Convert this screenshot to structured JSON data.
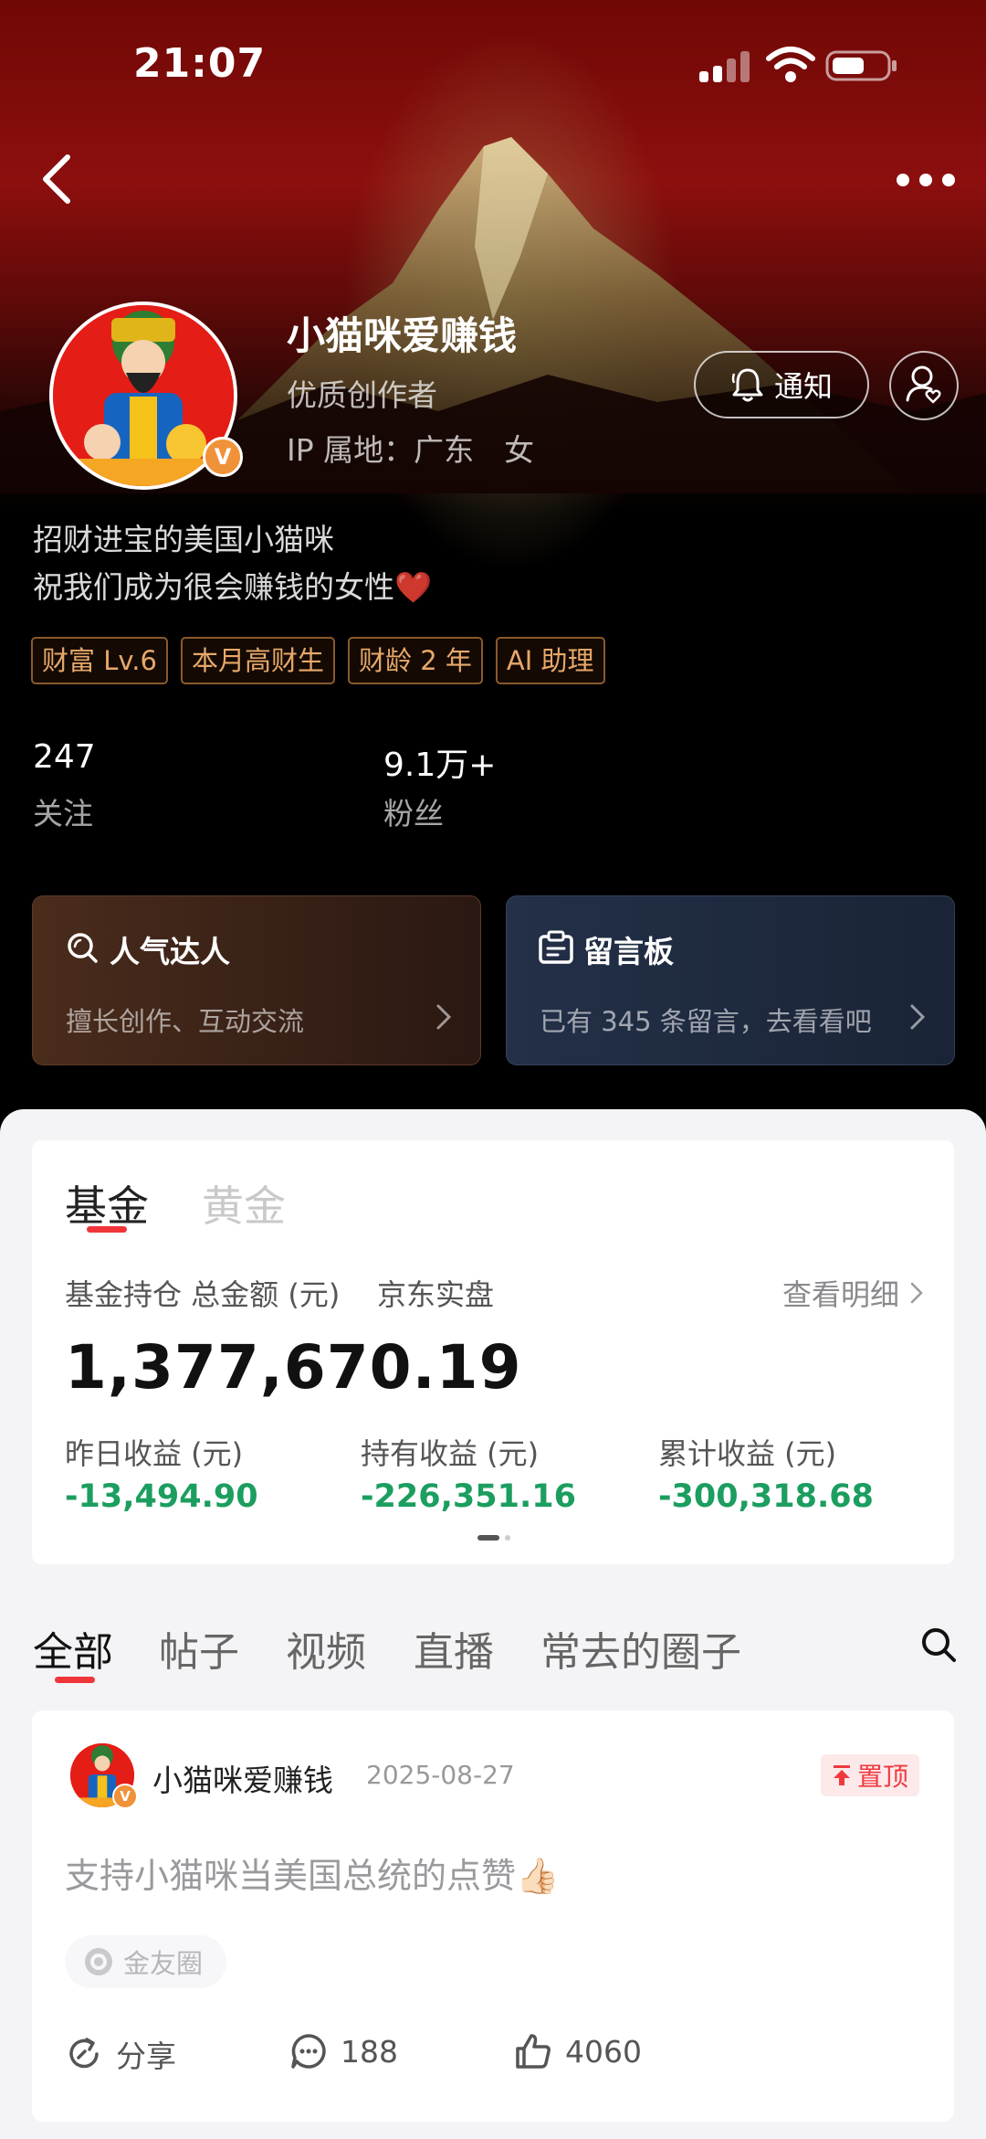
{
  "status_bar": {
    "time": "21:07"
  },
  "profile": {
    "nickname": "小猫咪爱赚钱",
    "verified_badge": "V",
    "role": "优质创作者",
    "ip_location": "IP 属地：广东　女",
    "notify_label": "通知",
    "bio_lines": [
      "招财进宝的美国小猫咪",
      "祝我们成为很会赚钱的女性❤️"
    ],
    "tags": [
      "财富 Lv.6",
      "本月高财生",
      "财龄 2 年",
      "AI 助理"
    ],
    "stats": [
      {
        "value": "247",
        "label": "关注"
      },
      {
        "value": "9.1万+",
        "label": "粉丝"
      }
    ]
  },
  "cards": {
    "popular": {
      "title": "人气达人",
      "subtitle": "擅长创作、互动交流",
      "icon": "search-icon"
    },
    "board": {
      "title": "留言板",
      "subtitle": "已有 345 条留言，去看看吧",
      "icon": "message-board-icon"
    }
  },
  "fund": {
    "tabs": [
      "基金",
      "黄金"
    ],
    "holding_label": "基金持仓 总金额 (元)",
    "platform": "京东实盘",
    "detail_link": "查看明细",
    "total": "1,377,670.19",
    "profits": [
      {
        "label": "昨日收益 (元)",
        "value": "-13,494.90"
      },
      {
        "label": "持有收益 (元)",
        "value": "-226,351.16"
      },
      {
        "label": "累计收益 (元)",
        "value": "-300,318.68"
      }
    ],
    "profit_color": "#1b9e5f"
  },
  "content_tabs": [
    "全部",
    "帖子",
    "视频",
    "直播",
    "常去的圈子"
  ],
  "post": {
    "author": "小猫咪爱赚钱",
    "date": "2025-08-27",
    "pinned_label": "置顶",
    "text": "支持小猫咪当美国总统的点赞👍🏻",
    "circle": "金友圈",
    "share_label": "分享",
    "comments": "188",
    "likes": "4060"
  },
  "colors": {
    "accent": "#f0353a",
    "tag_text": "#e7a86a",
    "header_red": "#8c0f0e"
  }
}
